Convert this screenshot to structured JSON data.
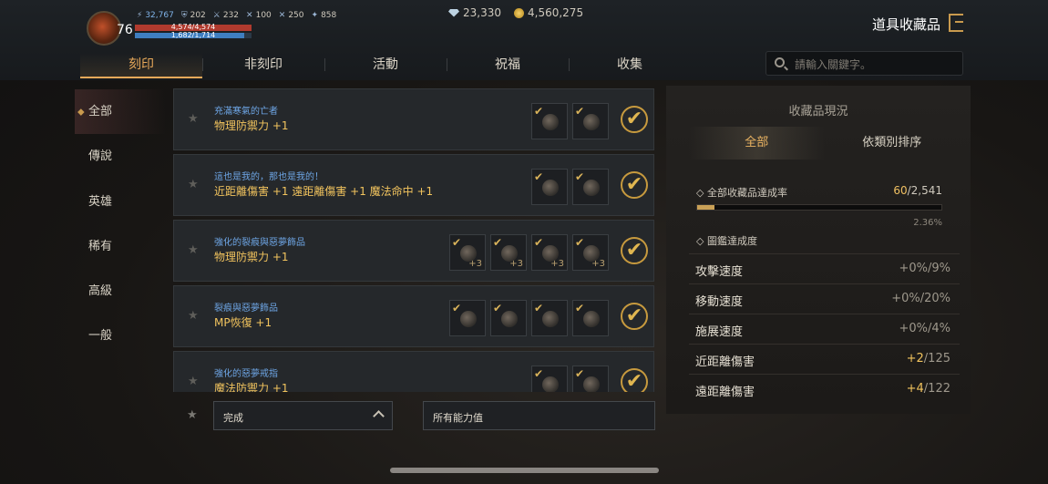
{
  "player": {
    "level": "76",
    "combat_power": "32,767",
    "stat1": "202",
    "stat2": "232",
    "stat3": "100",
    "stat4": "250",
    "stat5": "858",
    "hp": "4,574/4,574",
    "mp": "1,682/1,714"
  },
  "currency": {
    "gems": "23,330",
    "gold": "4,560,275"
  },
  "header": {
    "title": "道具收藏品"
  },
  "tabs": [
    {
      "label": "刻印"
    },
    {
      "label": "非刻印"
    },
    {
      "label": "活動"
    },
    {
      "label": "祝福"
    },
    {
      "label": "收集"
    }
  ],
  "search": {
    "placeholder": "請輸入關鍵字。"
  },
  "sidebar": {
    "items": [
      {
        "label": "全部"
      },
      {
        "label": "傳說"
      },
      {
        "label": "英雄"
      },
      {
        "label": "稀有"
      },
      {
        "label": "高級"
      },
      {
        "label": "一般"
      }
    ]
  },
  "collections": [
    {
      "name": "充滿寒氣的亡者",
      "effect": "物理防禦力 +1",
      "slot_count": 2,
      "plus": ""
    },
    {
      "name": "這也是我的，那也是我的！",
      "effect": "近距離傷害 +1 遠距離傷害 +1 魔法命中 +1",
      "slot_count": 2,
      "plus": ""
    },
    {
      "name": "強化的裂痕與惡夢飾品",
      "effect": "物理防禦力 +1",
      "slot_count": 4,
      "plus": "+3"
    },
    {
      "name": "裂痕與惡夢飾品",
      "effect": "MP恢復 +1",
      "slot_count": 4,
      "plus": ""
    },
    {
      "name": "強化的惡夢戒指",
      "effect": "魔法防禦力 +1",
      "slot_count": 2,
      "plus": ""
    }
  ],
  "filters": {
    "status": "完成",
    "ability": "所有能力值"
  },
  "panel": {
    "title": "收藏品現況",
    "tabs": [
      {
        "label": "全部"
      },
      {
        "label": "依類別排序"
      }
    ],
    "rate_label": "全部收藏品達成率",
    "rate_done": "60",
    "rate_total": "/2,541",
    "rate_percent": "2.36%",
    "rate_fraction": 0.0236,
    "codex_label": "圖鑑達成度",
    "stats": [
      {
        "label": "攻擊速度",
        "bonus": "+0%",
        "max": "/9%"
      },
      {
        "label": "移動速度",
        "bonus": "+0%",
        "max": "/20%"
      },
      {
        "label": "施展速度",
        "bonus": "+0%",
        "max": "/4%"
      },
      {
        "label": "近距離傷害",
        "bonus": "+2",
        "max": "/125"
      },
      {
        "label": "遠距離傷害",
        "bonus": "+4",
        "max": "/122"
      }
    ]
  }
}
